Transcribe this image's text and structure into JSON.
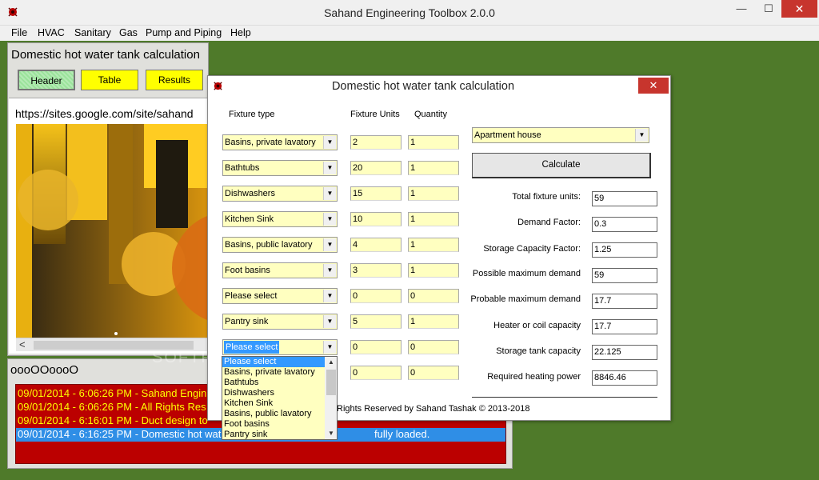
{
  "window": {
    "title": "Sahand Engineering Toolbox 2.0.0",
    "minimize": "—",
    "maximize": "☐",
    "close": "✕"
  },
  "menu": [
    "File",
    "HVAC",
    "Sanitary",
    "Gas",
    "Pump and Piping",
    "Help"
  ],
  "left_panel": {
    "title": "Domestic hot water tank calculation",
    "buttons": [
      "Header",
      "Table",
      "Results"
    ],
    "url": "https://sites.google.com/site/sahand",
    "scroll_left": "<"
  },
  "status": {
    "title": "oooOOoooO",
    "log": [
      "09/01/2014 - 6:06:26 PM - Sahand Engin",
      "09/01/2014 - 6:06:26 PM - All Rights Res",
      "09/01/2014 - 6:16:01 PM - Duct design to",
      "09/01/2014 - 6:16:25 PM - Domestic hot wat"
    ],
    "log_tail": "fully loaded."
  },
  "dialog": {
    "title": "Domestic hot water tank calculation",
    "close": "✕",
    "headers": {
      "fixture_type": "Fixture type",
      "fixture_units": "Fixture Units",
      "quantity": "Quantity"
    },
    "rows": [
      {
        "fixture": "Basins, private lavatory",
        "units": "2",
        "qty": "1"
      },
      {
        "fixture": "Bathtubs",
        "units": "20",
        "qty": "1"
      },
      {
        "fixture": "Dishwashers",
        "units": "15",
        "qty": "1"
      },
      {
        "fixture": "Kitchen Sink",
        "units": "10",
        "qty": "1"
      },
      {
        "fixture": "Basins, public lavatory",
        "units": "4",
        "qty": "1"
      },
      {
        "fixture": "Foot basins",
        "units": "3",
        "qty": "1"
      },
      {
        "fixture": "Please select",
        "units": "0",
        "qty": "0"
      },
      {
        "fixture": "Pantry sink",
        "units": "5",
        "qty": "1"
      },
      {
        "fixture": "Please select",
        "units": "0",
        "qty": "0"
      },
      {
        "fixture": "",
        "units": "0",
        "qty": "0"
      }
    ],
    "building_type": "Apartment house",
    "calculate": "Calculate",
    "results": [
      {
        "label": "Total fixture units:",
        "value": "59"
      },
      {
        "label": "Demand Factor:",
        "value": "0.3"
      },
      {
        "label": "Storage Capacity Factor:",
        "value": "1.25"
      },
      {
        "label": "Possible maximum demand",
        "value": "59"
      },
      {
        "label": "Probable maximum demand",
        "value": "17.7"
      },
      {
        "label": "Heater or coil capacity",
        "value": "17.7"
      },
      {
        "label": "Storage tank capacity",
        "value": "22.125"
      },
      {
        "label": "Required heating power",
        "value": "8846.46"
      }
    ],
    "copyright": "Rights Reserved by Sahand Tashak © 2013-2018"
  },
  "dropdown": {
    "items": [
      "Please select",
      "Basins, private lavatory",
      "Bathtubs",
      "Dishwashers",
      "Kitchen Sink",
      "Basins, public lavatory",
      "Foot basins",
      "Pantry sink"
    ],
    "up": "▲",
    "down": "▼"
  },
  "watermark": "SOFTPEDIA",
  "colors": {
    "desktop": "#4f7a2a",
    "log_bg": "#bb0000",
    "log_text": "#ffff00",
    "input_bg": "#ffffc0",
    "button_yellow": "#ffff00",
    "close_red": "#c7352d"
  }
}
